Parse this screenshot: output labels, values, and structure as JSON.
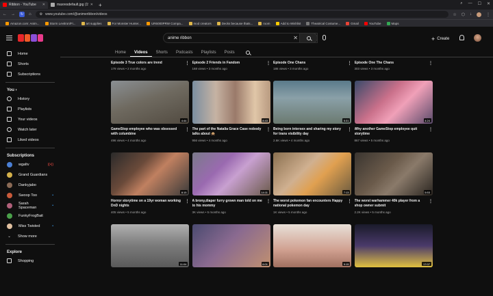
{
  "browser": {
    "tabs": [
      {
        "label": "Ribbon - YouTube",
        "active": true
      },
      {
        "label": "maxresdefault.jpg (1920×",
        "active": false
      }
    ],
    "url": "www.youtube.com/@animeribbon/videos",
    "bookmarks": [
      "Amazon.com: Anim...",
      "Storm Levitron/Fi...",
      "art supplies",
      "For Monster Hunter...",
      "UR6000PRW Compa...",
      "mod creators",
      "Decks because thats...",
      "room",
      "Add to Wishlist",
      "Theatrical Costume...",
      "Gmail",
      "YouTube",
      "Maps"
    ]
  },
  "youtube": {
    "search_query": "anime ribbon",
    "create_label": "Create"
  },
  "sidebar": {
    "main_items": [
      {
        "label": "Home",
        "icon": "home-icon"
      },
      {
        "label": "Shorts",
        "icon": "shorts-icon"
      },
      {
        "label": "Subscriptions",
        "icon": "subscriptions-icon"
      }
    ],
    "you_heading": "You",
    "you_items": [
      {
        "label": "History",
        "icon": "history-icon"
      },
      {
        "label": "Playlists",
        "icon": "playlists-icon"
      },
      {
        "label": "Your videos",
        "icon": "your-videos-icon"
      },
      {
        "label": "Watch later",
        "icon": "watch-later-icon"
      },
      {
        "label": "Liked videos",
        "icon": "liked-videos-icon"
      }
    ],
    "subs_heading": "Subscriptions",
    "subscriptions": [
      {
        "label": "wgaltv",
        "live": "((•))",
        "color": "#4a7fd4"
      },
      {
        "label": "Grand Guardians",
        "live": "",
        "color": "#d4b04a"
      },
      {
        "label": "Dankyjabo",
        "live": "",
        "color": "#8a6a55"
      },
      {
        "label": "Swoop Too",
        "live": "•",
        "color": "#c85a3a"
      },
      {
        "label": "Sarah Spaceman",
        "live": "•",
        "color": "#b0607a"
      },
      {
        "label": "FunkyFrogBait",
        "live": "",
        "color": "#4aa04a"
      },
      {
        "label": "Miss Twisted",
        "live": "•",
        "color": "#e0c0a0"
      }
    ],
    "show_more": "Show more",
    "explore_heading": "Explore",
    "explore_items": [
      {
        "label": "Shopping",
        "icon": "shopping-icon"
      }
    ]
  },
  "channel_tabs": [
    "Home",
    "Videos",
    "Shorts",
    "Podcasts",
    "Playlists",
    "Posts"
  ],
  "selected_tab": "Videos",
  "top_strip": [
    {
      "title": "Episode 3 True colors are trend",
      "meta": "179 views • 2 months ago"
    },
    {
      "title": "Episode 2 Friends in Fandom",
      "meta": "168 views • 3 months ago"
    },
    {
      "title": "Episode One Chans",
      "meta": "186 views • 3 months ago"
    },
    {
      "title": "Episode One The Chans",
      "meta": "303 views • 3 months ago"
    }
  ],
  "videos": [
    [
      {
        "title": "GameStop employee who was obsessed with columbine",
        "meta": "496 views • 4 months ago",
        "duration": "4:44",
        "bg": "linear-gradient(160deg,#8a8f93 0%,#6f6a60 45%,#514a40 100%)"
      },
      {
        "title": "The part of the Natalia Grace Case nobody talks about 🙊",
        "meta": "956 views • 4 months ago",
        "duration": "8:43",
        "bg": "linear-gradient(90deg,#7b8ea0 0%,#c6b3a3 30%,#9a7a6a 55%,#e0c6a8 80%,#b89a80 100%)"
      },
      {
        "title": "Being born intersex and sharing my story for trans visibility day",
        "meta": "2.6K views • 4 months ago",
        "duration": "5:31",
        "bg": "linear-gradient(180deg,#5a7a8a 0%,#8aa0a8 40%,#6b7a70 100%)"
      },
      {
        "title": "Why another GameStop employee quit storytime",
        "meta": "867 views • 5 months ago",
        "duration": "4:24",
        "bg": "linear-gradient(135deg,#3a4a6a 0%,#c9708a 40%,#f0a0b8 60%,#5a4a6a 100%)"
      }
    ],
    [
      {
        "title": "Horror storytime on a 19yr woman working DnD nights",
        "meta": "405 views • 5 months ago",
        "duration": "8:15",
        "bg": "linear-gradient(135deg,#2a2a2a 0%,#6a4a3a 35%,#c08060 55%,#3a3a3a 100%)"
      },
      {
        "title": "A brony,diaper furry grown man told on me to his mommy",
        "meta": "3K views • 5 months ago",
        "duration": "14:11",
        "bg": "linear-gradient(135deg,#7a7a8a 0%,#9a6ab0 35%,#c8a0d0 55%,#6a5a4a 100%)"
      },
      {
        "title": "The worst pokemon fan encounters Happy national pokemon day",
        "meta": "1K views • 5 months ago",
        "duration": "7:13",
        "bg": "linear-gradient(135deg,#8a7050 0%,#d0b090 40%,#e0a050 60%,#6a5a40 100%)"
      },
      {
        "title": "The worst warhammer 40k player from a shop owner submit",
        "meta": "2.2K views • 5 months ago",
        "duration": "5:53",
        "bg": "linear-gradient(135deg,#3a3530 0%,#6a5a4a 40%,#8a7a6a 60%,#2a2520 100%)"
      }
    ],
    [
      {
        "title": "",
        "meta": "",
        "duration": "11:04",
        "bg": "linear-gradient(180deg,#b0b0b0 0%,#7a7a7a 50%,#5a5a5a 100%)"
      },
      {
        "title": "",
        "meta": "",
        "duration": "6:01",
        "bg": "linear-gradient(135deg,#4a4a70 0%,#8a6a90 45%,#c09070 100%)"
      },
      {
        "title": "",
        "meta": "",
        "duration": "9:15",
        "bg": "linear-gradient(180deg,#e8e0d8 0%,#d0a090 60%,#a07060 100%)"
      },
      {
        "title": "",
        "meta": "",
        "duration": "17:07",
        "bg": "linear-gradient(180deg,#1a1a2a 0%,#4a3a6a 50%,#e0c040 100%)"
      }
    ]
  ]
}
